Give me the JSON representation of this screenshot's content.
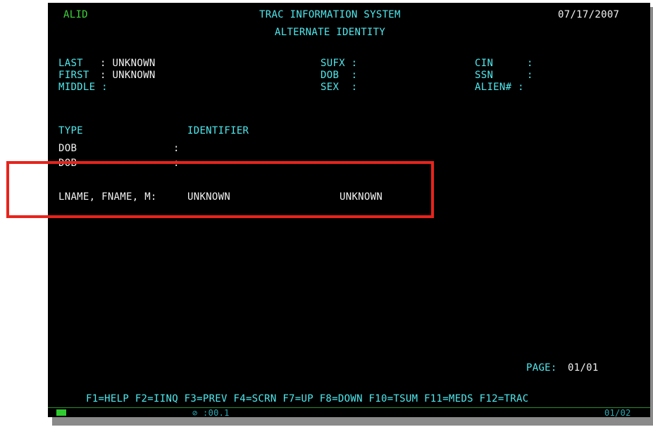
{
  "header": {
    "screen_code": "ALID",
    "system_title": "TRAC INFORMATION SYSTEM",
    "screen_title": "ALTERNATE IDENTITY",
    "date": "07/17/2007"
  },
  "person": {
    "last_label": "LAST",
    "last_value": ": UNKNOWN",
    "first_label": "FIRST",
    "first_value": ": UNKNOWN",
    "middle_label": "MIDDLE :",
    "sufx_label": "SUFX :",
    "dob_label": "DOB  :",
    "sex_label": "SEX  :",
    "cin_label": "CIN",
    "cin_colon": ":",
    "ssn_label": "SSN",
    "ssn_colon": ":",
    "alien_label": "ALIEN# :"
  },
  "table": {
    "col_type": "TYPE",
    "col_identifier": "IDENTIFIER",
    "rows": [
      {
        "type": "DOB",
        "sep": ":"
      },
      {
        "type": "DOB",
        "sep": ":"
      }
    ],
    "name_row": {
      "label": "LNAME, FNAME, M:",
      "value1": "UNKNOWN",
      "value2": "UNKNOWN"
    }
  },
  "footer": {
    "page_label": "PAGE:",
    "page_value": "01/01",
    "function_keys": "F1=HELP F2=IINQ F3=PREV F4=SCRN F7=UP F8=DOWN F10=TSUM F11=MEDS F12=TRAC",
    "status_timer": "⊘ :00.1",
    "status_position": "01/02"
  },
  "colors": {
    "screen_bg": "#000000",
    "label_cyan": "#4fe9ee",
    "value_white": "#f2f2f2",
    "highlight_red": "#e8231b",
    "status_green": "#3fd23a"
  }
}
